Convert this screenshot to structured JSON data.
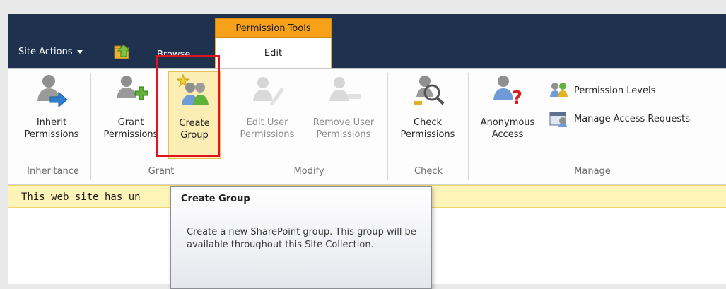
{
  "topbar": {
    "site_actions": "Site Actions",
    "browse": "Browse",
    "context_group": "Permission Tools",
    "edit_tab": "Edit"
  },
  "ribbon": {
    "inherit": {
      "line1": "Inherit",
      "line2": "Permissions"
    },
    "grant": {
      "line1": "Grant",
      "line2": "Permissions"
    },
    "create_group": {
      "line1": "Create",
      "line2": "Group"
    },
    "edit_user": {
      "line1": "Edit User",
      "line2": "Permissions"
    },
    "remove_user": {
      "line1": "Remove User",
      "line2": "Permissions"
    },
    "check": {
      "line1": "Check",
      "line2": "Permissions"
    },
    "anonymous": {
      "line1": "Anonymous",
      "line2": "Access"
    },
    "permission_levels": "Permission Levels",
    "manage_access": "Manage Access Requests",
    "groups": {
      "inheritance": "Inheritance",
      "grant": "Grant",
      "modify": "Modify",
      "check": "Check",
      "manage": "Manage"
    }
  },
  "notice": "This web site has un",
  "tooltip": {
    "title": "Create Group",
    "body": "Create a new SharePoint group. This group will be available throughout this Site Collection."
  }
}
